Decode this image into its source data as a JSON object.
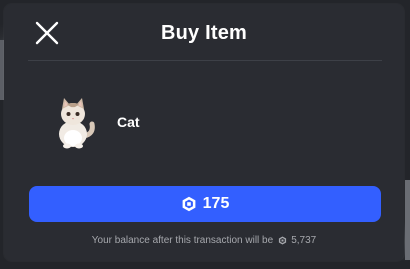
{
  "dialog": {
    "title": "Buy Item",
    "close_icon": "close-icon"
  },
  "item": {
    "name": "Cat",
    "thumbnail_icon": "cat-figure"
  },
  "purchase": {
    "price": "175",
    "currency_icon": "robux-icon",
    "button_color": "#335fff"
  },
  "balance": {
    "text": "Your balance after this transaction will be",
    "amount": "5,737",
    "currency_icon": "robux-icon"
  }
}
